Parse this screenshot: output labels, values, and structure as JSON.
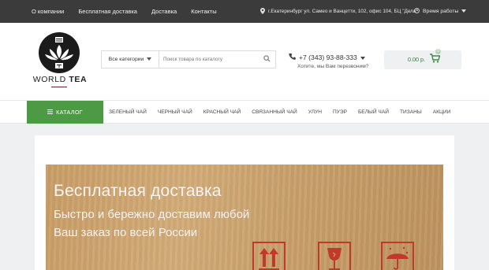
{
  "topbar": {
    "nav": [
      "О компании",
      "Бесплатная доставка",
      "Доставка",
      "Контакты"
    ],
    "address": "г.Екатеринбург ул. Самео и Ванцетти, 102, офис 104, БЦ \"Дела\"",
    "hours_label": "Время работы"
  },
  "header": {
    "logo_text_1": "WORLD",
    "logo_text_2": "TEA",
    "search": {
      "category": "Все категории",
      "placeholder": "Поиск товара по каталогу"
    },
    "phone": "+7 (343) 93-88-333",
    "callback": "Хотите, мы Вам перезвоним?",
    "cart_sum": "0.00 р.",
    "cart_count": "0"
  },
  "menu": {
    "catalog_label": "КАТАЛОГ",
    "items": [
      "ЗЕЛЕНЫЙ ЧАЙ",
      "ЧЕРНЫЙ ЧАЙ",
      "КРАСНЫЙ ЧАЙ",
      "СВЯЗАННЫЙ ЧАЙ",
      "УЛУН",
      "ПУЭР",
      "БЕЛЫЙ ЧАЙ",
      "ТИЗАНЫ",
      "АКЦИИ"
    ]
  },
  "banner": {
    "title": "Бесплатная доставка",
    "line1": "Быстро и бережно доставим любой",
    "line2": "Ваш заказ по всей России"
  },
  "colors": {
    "topbar": "#3b3b3b",
    "catalog_green": "#4d9a45",
    "cart_green": "#2d7a3b",
    "banner_cardboard": "#c9a06c",
    "warning_red": "#c0392b"
  }
}
